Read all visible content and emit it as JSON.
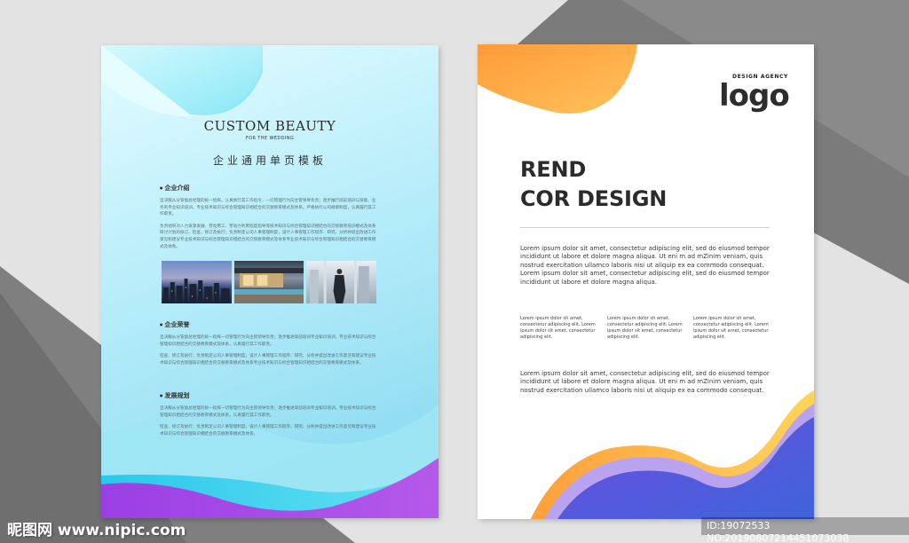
{
  "left_flyer": {
    "title": "CUSTOM BEAUTY",
    "subtitle": "FOR THE WEDDING",
    "heading": "企业通用单页模板",
    "sections": [
      {
        "title": "企业介绍",
        "paragraphs": [
          "坚决服从分管副总经理的统一指挥，认真执行其工作指令，一切管理行为向主管领导负责；逐步推行岗前培训与技能、业务的专业知识培训，专业技术知识与综合管理知识相结合的交替教育模式及体系，严格执行公司规章制度，认真履行其工作职责。",
          "负责组织对人力资源发展、劳动用工、劳动力利用程度指导等技术知识与综合管理知识相结合的交替教育培训模式及体系研讨计划的拟订、检查、修订及执行；负责制定公司人事管理制度，设计人事管理工作程序、研究、分析并提出改进工作意见和建议专业技术知识与综合管理知识相结合的交替教育模式及体系专业技术知识与综合管理知识相结合的交替教育模式及体系。"
        ]
      },
      {
        "title": "企业荣誉",
        "paragraphs": [
          "坚决服从分管副总经理的统一指挥一切管理行为向主管领导负责；逐步推进岗前培训专业知识培训，专业技术知识与综合管理知识相结合的交替教育模式及体系，认真履行其工作职责。",
          "检查、修订及执行；负责制定公司人事管理制度，设计人事管理工作程序、研究、分析并提出改进工作意见和建议专业技术知识与综合管理知识相结合的交替教育模式及体系专业技术知识与综合管理知识相结合的交替教育模式及体系。"
        ]
      },
      {
        "title": "发展规划",
        "paragraphs": [
          "坚决服从分管副总经理的统一指挥一切管理行为向主管领导负责；逐步推进岗前培训专业知识培训，专业技术知识与综合管理知识相结合的交替教育模式及体系，认真履行其工作职责。",
          "检查、修订及执行；负责制定公司人事管理制度，设计人事管理工作程序、研究、分析并提出改进工作意见和建议专业技术知识与综合管理知识相结合的交替教育模式及体系。"
        ]
      }
    ],
    "colors": {
      "cyan": "#3fd3ee",
      "violet": "#9b45e6",
      "purple_deep": "#7b3fe0"
    }
  },
  "right_flyer": {
    "agency": "DESIGN AGENCY",
    "logo": "logo",
    "title_line1": "REND",
    "title_line2": "COR DESIGN",
    "paragraph1": "Lorem ipsum dolor sit amet, consectetur adipiscing elit, sed do eiusmod tempor incididunt ut labore et dolore magna aliqua. Ut eni m ad mZinim veniam, quis nostrud exercitation ullamco laboris nisi ut aliquip ex ea commodo consequat. Lorem ipsum dolor sit amet, consectetur adipiscing elit, sed do eiusmod tempor incididunt ut labore et dolore magna aliqua.",
    "columns": [
      "Lorem ipsum dolor sit amet, consectetur adipiscing elit. Lorem ipsum dolor sit amet, consectetur adipiscing elit.",
      "Lorem ipsum dolor sit amet, consectetur adipiscing elit. Lorem ipsum dolor sit amet, consectetur adipiscing elit.",
      "Lorem ipsum dolor sit amet, consectetur adipiscing elit. Lorem ipsum dolor sit amet, consectetur adipiscing elit."
    ],
    "paragraph2": "Lorem ipsum dolor sit amet, consectetur adipiscing elit, sed do eiusmod tempor incididunt ut labore et dolore magna aliqua. Ut eni m ad mZinim veniam, quis nostrud exercitation ullamco laboris nisi ut aliquip ex ea commodo consequat.",
    "colors": {
      "orange": "#ffab3c",
      "yellow": "#ffd25a",
      "lavender": "#b9a3f0",
      "blue": "#5567e0"
    }
  },
  "watermark": {
    "site": "昵图网 www.nipic.com",
    "id": "ID:19072533 NO:20190807214451073038"
  }
}
